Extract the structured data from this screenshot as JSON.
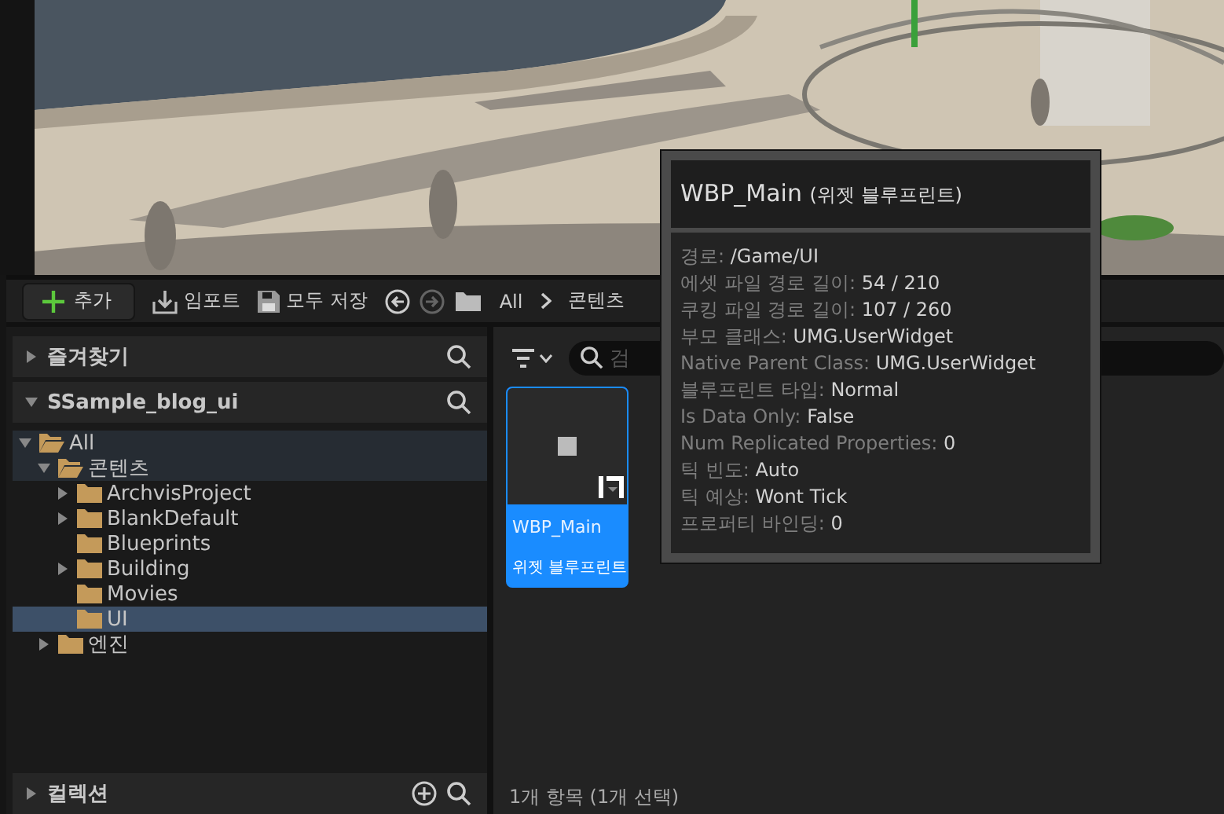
{
  "toolbar": {
    "add_button": "추가",
    "import_button": "임포트",
    "save_all_button": "모두 저장",
    "back_enabled": true,
    "forward_enabled": false,
    "breadcrumb": [
      "All",
      "콘텐츠"
    ]
  },
  "sources": {
    "favorites": {
      "title": "즐겨찾기",
      "expanded": false
    },
    "project": {
      "title": "SSample_blog_ui",
      "expanded": true
    },
    "tree": [
      {
        "label": "All",
        "expanded": true,
        "selected": false,
        "children": [
          {
            "label": "콘텐츠",
            "expanded": true,
            "selected": false,
            "children": [
              {
                "label": "ArchvisProject",
                "expanded": false,
                "selected": false
              },
              {
                "label": "BlankDefault",
                "expanded": false,
                "selected": false
              },
              {
                "label": "Blueprints",
                "selected": false
              },
              {
                "label": "Building",
                "expanded": false,
                "selected": false
              },
              {
                "label": "Movies",
                "selected": false
              },
              {
                "label": "UI",
                "selected": true
              }
            ]
          },
          {
            "label": "엔진",
            "expanded": false,
            "selected": false
          }
        ]
      }
    ],
    "collections": {
      "title": "컬렉션",
      "expanded": false
    }
  },
  "assets": {
    "search": {
      "placeholder": "검"
    },
    "items": [
      {
        "name": "WBP_Main",
        "type": "위젯 블루프린트",
        "selected": true
      }
    ],
    "status": "1개 항목 (1개 선택)"
  },
  "tooltip": {
    "title": "WBP_Main",
    "subtitle": "(위젯 블루프린트)",
    "properties": [
      {
        "key": "경로:",
        "value": "/Game/UI"
      },
      {
        "key": "에셋 파일 경로 길이:",
        "value": "54 / 210"
      },
      {
        "key": "쿠킹 파일 경로 길이:",
        "value": "107 / 260"
      },
      {
        "key": "부모 클래스:",
        "value": "UMG.UserWidget"
      },
      {
        "key": "Native Parent Class:",
        "value": "UMG.UserWidget"
      },
      {
        "key": "블루프린트 타입:",
        "value": "Normal"
      },
      {
        "key": "Is Data Only:",
        "value": "False"
      },
      {
        "key": "Num Replicated Properties:",
        "value": "0"
      },
      {
        "key": "틱 빈도:",
        "value": "Auto"
      },
      {
        "key": "틱 예상:",
        "value": "Wont Tick"
      },
      {
        "key": "프로퍼티 바인딩:",
        "value": "0"
      }
    ]
  }
}
